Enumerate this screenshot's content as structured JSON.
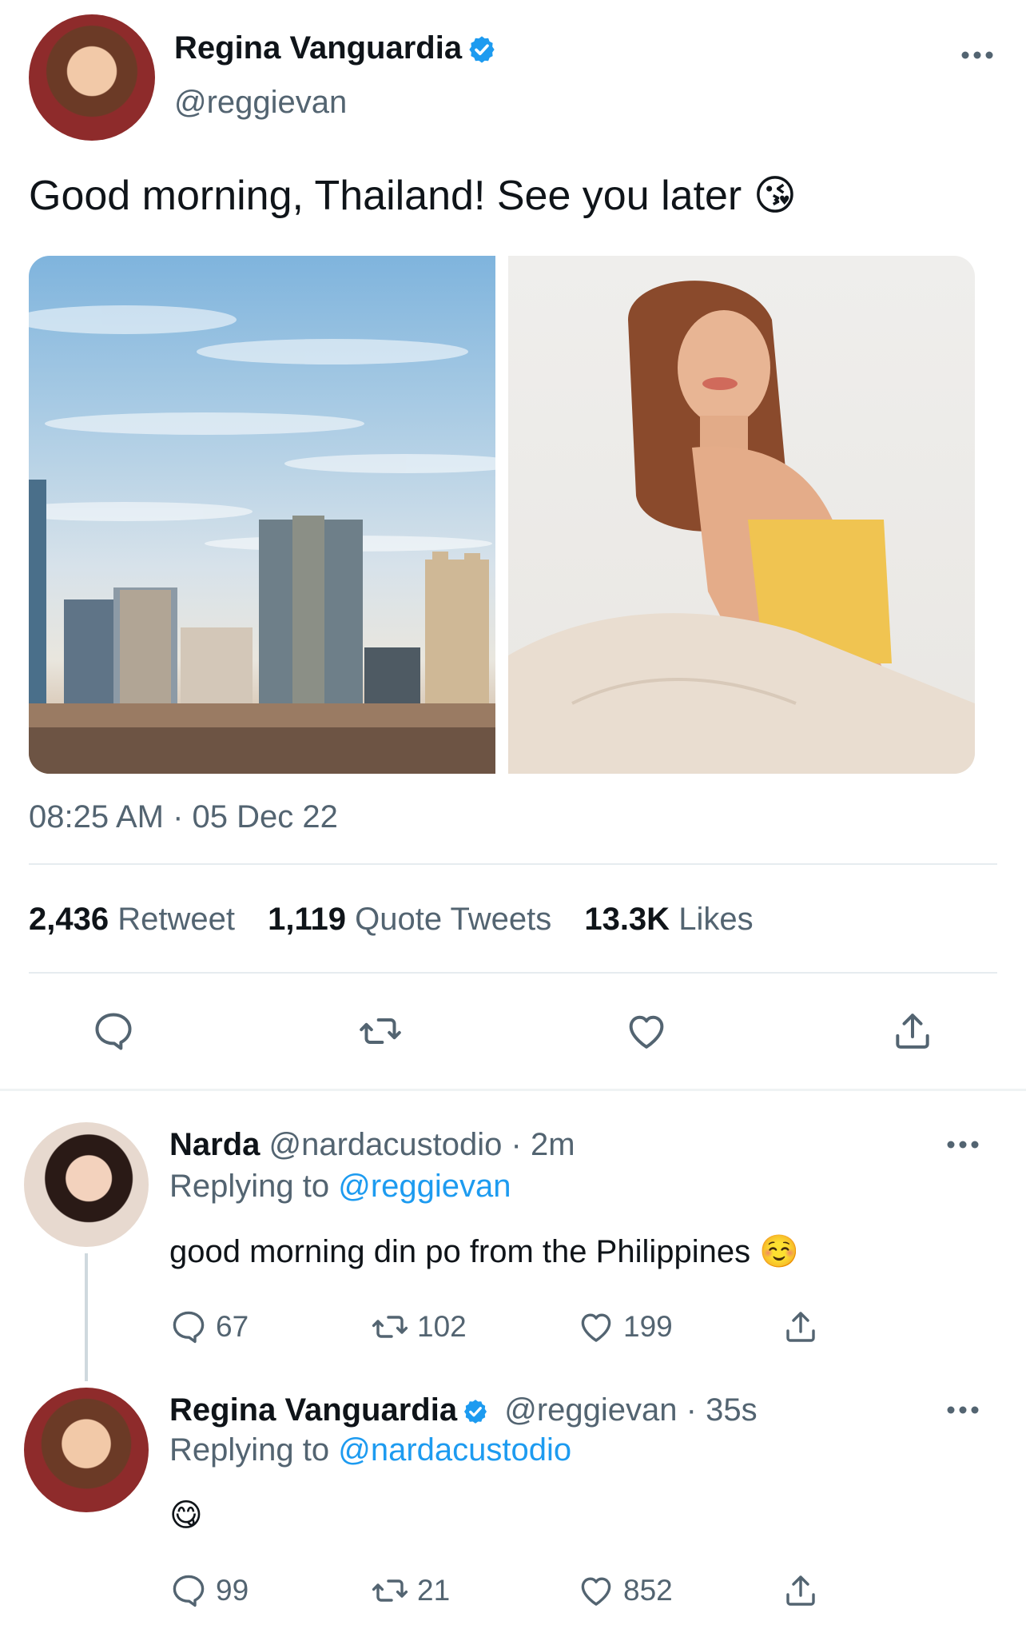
{
  "tweet": {
    "author_name": "Regina Vanguardia",
    "author_handle": "@reggievan",
    "text": "Good morning, Thailand! See you later 😘",
    "timestamp": "08:25 AM · 05 Dec 22",
    "stats": {
      "retweets_count": "2,436",
      "retweets_label": "Retweet",
      "quotes_count": "1,119",
      "quotes_label": "Quote Tweets",
      "likes_count": "13.3K",
      "likes_label": "Likes"
    }
  },
  "replies": [
    {
      "author_name": "Narda",
      "author_handle": "@nardacustodio",
      "time": "· 2m",
      "replying_prefix": "Replying to",
      "replying_to": "@reggievan",
      "text": "good morning din po from the Philippines ☺️",
      "replies": "67",
      "retweets": "102",
      "likes": "199"
    },
    {
      "author_name": "Regina Vanguardia",
      "author_handle": "@reggievan",
      "time": "· 35s",
      "replying_prefix": "Replying to",
      "replying_to": "@nardacustodio",
      "text": "😋",
      "replies": "99",
      "retweets": "21",
      "likes": "852"
    }
  ],
  "colors": {
    "accent": "#1d9bf0",
    "secondary_text": "#536471",
    "divider": "#e6ecf0"
  },
  "icons": {
    "verified": "verified-badge-icon",
    "more": "more-horizontal-icon",
    "reply": "reply-bubble-icon",
    "retweet": "retweet-icon",
    "like": "heart-icon",
    "share": "share-upload-icon"
  }
}
